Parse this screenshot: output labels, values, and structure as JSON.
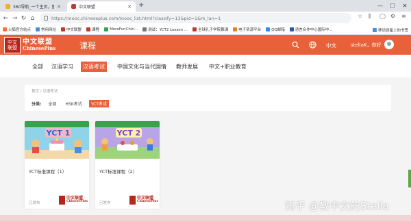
{
  "browser": {
    "tabs": [
      {
        "title": "360导航_一个主页，整个世界",
        "active": false,
        "favicon_color": "#f2b01e"
      },
      {
        "title": "中文联盟",
        "active": true,
        "favicon_color": "#c0392b"
      }
    ],
    "url": "https://mooc.chineseplus.com/mooc_list.html?classify=13&pid=1&m_lan=1",
    "bookmarks": [
      {
        "label": "火狐官方站点",
        "color": "#ff7139"
      },
      {
        "label": "常用网址",
        "color": "#4a90d9"
      },
      {
        "label": "中文联盟",
        "color": "#c0392b"
      },
      {
        "label": "课程",
        "color": "#c0392b"
      },
      {
        "label": "MoreFunChin...",
        "color": "#2aa84a"
      },
      {
        "label": "测试：YCT2 Lesson ...",
        "color": "#777777"
      },
      {
        "label": "全球孔子学院慕课",
        "color": "#c0392b"
      },
      {
        "label": "电子资源平台",
        "color": "#e67e22"
      },
      {
        "label": "QQ邮箱",
        "color": "#2d8cf0"
      },
      {
        "label": "语言合作中心国际中...",
        "color": "#2c5aa0"
      }
    ],
    "bookmarks_right": "移动设备上的书签"
  },
  "site": {
    "logo_cn": "中文联盟",
    "logo_en": "ChinesePlus",
    "title": "课程",
    "lang": "中文",
    "user_greeting": "stellaK，你好",
    "accent_color": "#e9613b"
  },
  "categories": [
    {
      "label": "全部",
      "active": false
    },
    {
      "label": "汉语学习",
      "active": false
    },
    {
      "label": "汉语考试",
      "active": true
    },
    {
      "label": "中国文化与当代国情",
      "active": false
    },
    {
      "label": "教师发展",
      "active": false
    },
    {
      "label": "中文+职业教育",
      "active": false
    }
  ],
  "breadcrumb": "首页 / 汉语考试",
  "filter": {
    "label": "分类:",
    "options": [
      {
        "label": "全部",
        "active": false
      },
      {
        "label": "HSK考试",
        "active": false
      },
      {
        "label": "YCT考试",
        "active": true
      }
    ]
  },
  "courses": [
    {
      "title": "YCT标准课程（1）",
      "status": "已发布",
      "cover_label": "YCT 1"
    },
    {
      "title": "YCT标准课程（2）",
      "status": "已发布",
      "cover_label": "YCT 2"
    }
  ],
  "watermark": "知乎 @教中文的Stella"
}
